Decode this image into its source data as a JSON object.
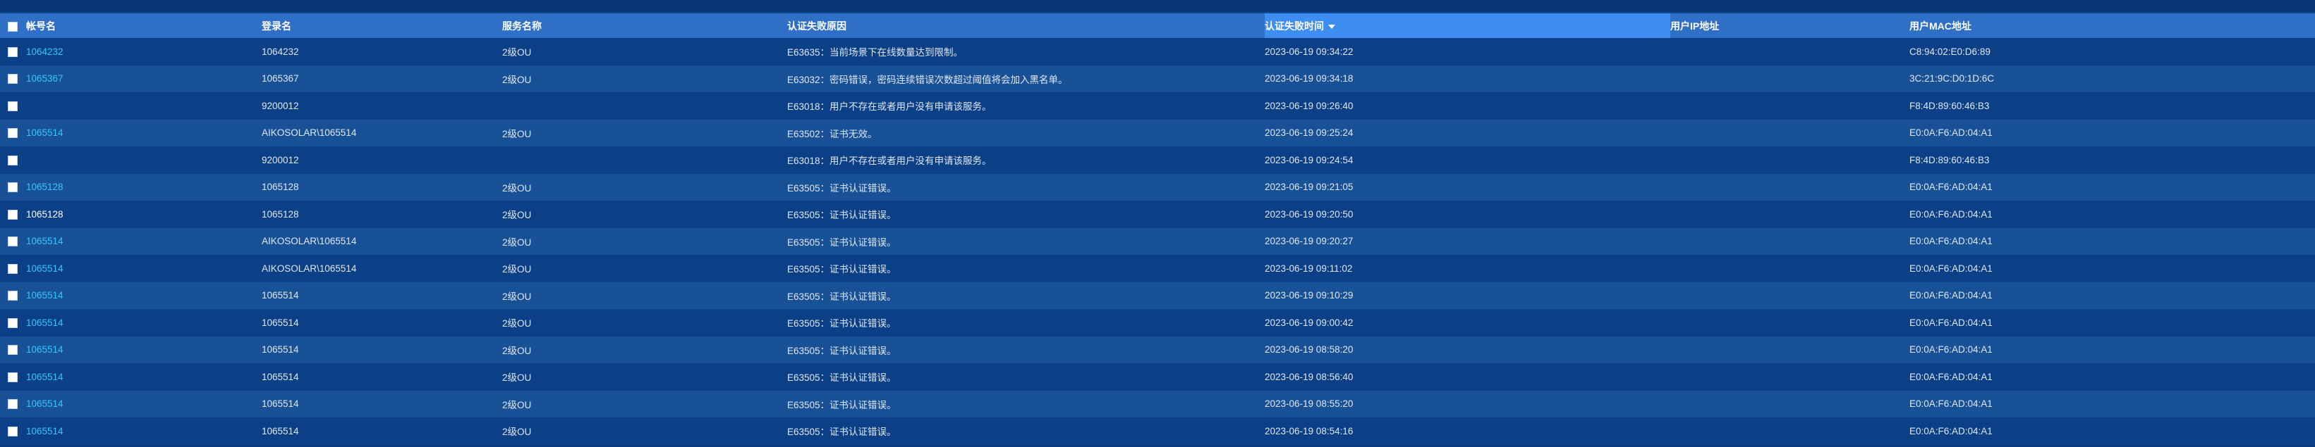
{
  "table": {
    "headers": {
      "account": "帐号名",
      "login": "登录名",
      "service": "服务名称",
      "reason": "认证失败原因",
      "time": "认证失败时间",
      "ip": "用户IP地址",
      "mac": "用户MAC地址"
    },
    "rows": [
      {
        "account": "1064232",
        "login": "1064232",
        "service": "2级OU",
        "reason": "E63635：当前场景下在线数量达到限制。",
        "time": "2023-06-19 09:34:22",
        "ip": "",
        "mac": "C8:94:02:E0:D6:89"
      },
      {
        "account": "1065367",
        "login": "1065367",
        "service": "2级OU",
        "reason": "E63032：密码错误，密码连续错误次数超过阈值将会加入黑名单。",
        "time": "2023-06-19 09:34:18",
        "ip": "",
        "mac": "3C:21:9C:D0:1D:6C"
      },
      {
        "account": "",
        "login": "9200012",
        "service": "",
        "reason": "E63018：用户不存在或者用户没有申请该服务。",
        "time": "2023-06-19 09:26:40",
        "ip": "",
        "mac": "F8:4D:89:60:46:B3"
      },
      {
        "account": "1065514",
        "login": "AIKOSOLAR\\1065514",
        "service": "2级OU",
        "reason": "E63502：证书无效。",
        "time": "2023-06-19 09:25:24",
        "ip": "",
        "mac": "E0:0A:F6:AD:04:A1"
      },
      {
        "account": "",
        "login": "9200012",
        "service": "",
        "reason": "E63018：用户不存在或者用户没有申请该服务。",
        "time": "2023-06-19 09:24:54",
        "ip": "",
        "mac": "F8:4D:89:60:46:B3"
      },
      {
        "account": "1065128",
        "login": "1065128",
        "service": "2级OU",
        "reason": "E63505：证书认证错误。",
        "time": "2023-06-19 09:21:05",
        "ip": "",
        "mac": "E0:0A:F6:AD:04:A1"
      },
      {
        "account": "1065128",
        "login": "1065128",
        "service": "2级OU",
        "reason": "E63505：证书认证错误。",
        "time": "2023-06-19 09:20:50",
        "ip": "",
        "mac": "E0:0A:F6:AD:04:A1"
      },
      {
        "account": "1065514",
        "login": "AIKOSOLAR\\1065514",
        "service": "2级OU",
        "reason": "E63505：证书认证错误。",
        "time": "2023-06-19 09:20:27",
        "ip": "",
        "mac": "E0:0A:F6:AD:04:A1"
      },
      {
        "account": "1065514",
        "login": "AIKOSOLAR\\1065514",
        "service": "2级OU",
        "reason": "E63505：证书认证错误。",
        "time": "2023-06-19 09:11:02",
        "ip": "",
        "mac": "E0:0A:F6:AD:04:A1"
      },
      {
        "account": "1065514",
        "login": "1065514",
        "service": "2级OU",
        "reason": "E63505：证书认证错误。",
        "time": "2023-06-19 09:10:29",
        "ip": "",
        "mac": "E0:0A:F6:AD:04:A1"
      },
      {
        "account": "1065514",
        "login": "1065514",
        "service": "2级OU",
        "reason": "E63505：证书认证错误。",
        "time": "2023-06-19 09:00:42",
        "ip": "",
        "mac": "E0:0A:F6:AD:04:A1"
      },
      {
        "account": "1065514",
        "login": "1065514",
        "service": "2级OU",
        "reason": "E63505：证书认证错误。",
        "time": "2023-06-19 08:58:20",
        "ip": "",
        "mac": "E0:0A:F6:AD:04:A1"
      },
      {
        "account": "1065514",
        "login": "1065514",
        "service": "2级OU",
        "reason": "E63505：证书认证错误。",
        "time": "2023-06-19 08:56:40",
        "ip": "",
        "mac": "E0:0A:F6:AD:04:A1"
      },
      {
        "account": "1065514",
        "login": "1065514",
        "service": "2级OU",
        "reason": "E63505：证书认证错误。",
        "time": "2023-06-19 08:55:20",
        "ip": "",
        "mac": "E0:0A:F6:AD:04:A1"
      },
      {
        "account": "1065514",
        "login": "1065514",
        "service": "2级OU",
        "reason": "E63505：证书认证错误。",
        "time": "2023-06-19 08:54:16",
        "ip": "",
        "mac": "E0:0A:F6:AD:04:A1"
      }
    ]
  }
}
